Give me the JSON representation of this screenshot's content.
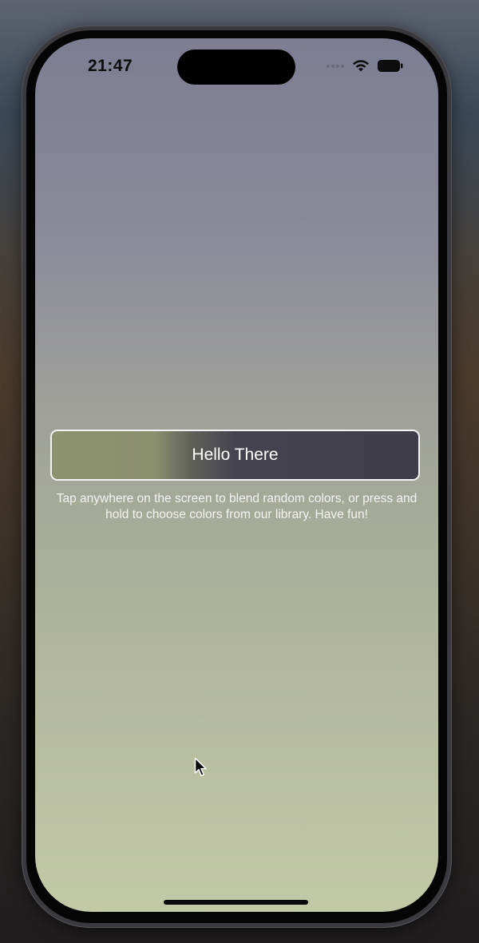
{
  "status_bar": {
    "time": "21:47",
    "wifi_icon": "wifi-icon",
    "battery_icon": "battery-icon"
  },
  "main": {
    "button_label": "Hello There",
    "hint": "Tap anywhere on the screen to blend random colors, or press and hold to choose colors from our library. Have fun!"
  },
  "colors": {
    "gradient_top": "#7d7d93",
    "gradient_bottom": "#c2c9a6",
    "button_left": "#8d9271",
    "button_right": "#3f3d4a"
  }
}
